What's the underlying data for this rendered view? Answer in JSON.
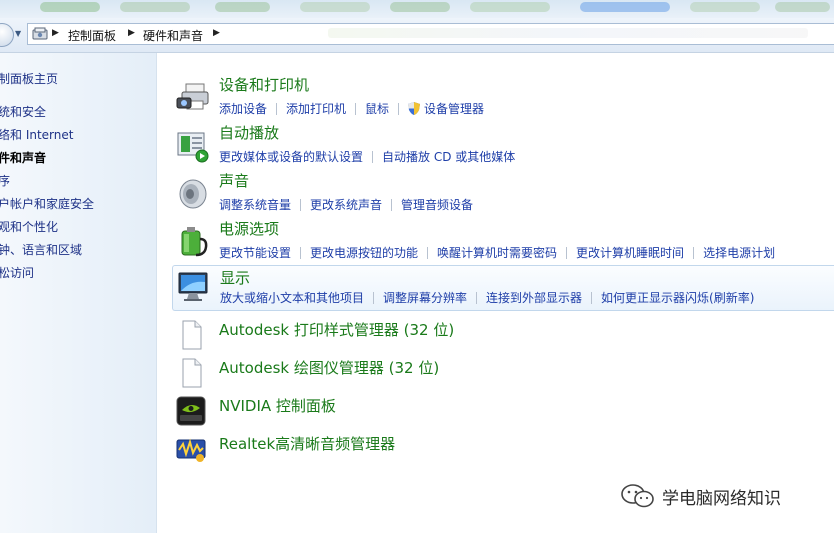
{
  "address_bar": {
    "crumbs": [
      "控制面板",
      "硬件和声音"
    ]
  },
  "left_pane": {
    "items": [
      {
        "label": "制面板主页",
        "active": false
      },
      {
        "label": "统和安全",
        "active": false
      },
      {
        "label": "络和 Internet",
        "active": false
      },
      {
        "label": "件和声音",
        "active": true
      },
      {
        "label": "序",
        "active": false
      },
      {
        "label": "户帐户和家庭安全",
        "active": false
      },
      {
        "label": "观和个性化",
        "active": false
      },
      {
        "label": "钟、语言和区域",
        "active": false
      },
      {
        "label": "松访问",
        "active": false
      }
    ]
  },
  "categories": [
    {
      "title": "设备和打印机",
      "icon": "devices-printers-icon",
      "links": [
        "添加设备",
        "添加打印机",
        "鼠标",
        "设备管理器"
      ]
    },
    {
      "title": "自动播放",
      "icon": "autoplay-icon",
      "links": [
        "更改媒体或设备的默认设置",
        "自动播放 CD 或其他媒体"
      ]
    },
    {
      "title": "声音",
      "icon": "speaker-icon",
      "links": [
        "调整系统音量",
        "更改系统声音",
        "管理音频设备"
      ]
    },
    {
      "title": "电源选项",
      "icon": "power-options-icon",
      "links": [
        "更改节能设置",
        "更改电源按钮的功能",
        "唤醒计算机时需要密码",
        "更改计算机睡眠时间",
        "选择电源计划"
      ]
    },
    {
      "title": "显示",
      "icon": "display-icon",
      "links": [
        "放大或缩小文本和其他项目",
        "调整屏幕分辨率",
        "连接到外部显示器",
        "如何更正显示器闪烁(刷新率)"
      ]
    }
  ],
  "extra_items": [
    {
      "title": "Autodesk 打印样式管理器 (32 位)",
      "icon": "document-icon"
    },
    {
      "title": "Autodesk 绘图仪管理器 (32 位)",
      "icon": "document-icon"
    },
    {
      "title": "NVIDIA 控制面板",
      "icon": "nvidia-icon"
    },
    {
      "title": "Realtek高清晰音频管理器",
      "icon": "realtek-audio-icon"
    }
  ],
  "watermark": {
    "text": "学电脑网络知识"
  },
  "colors": {
    "category_title": "#1a7a1a",
    "link": "#1e3ea8",
    "left_pane_link": "#1e3287",
    "highlight_border": "#c2d7ec"
  }
}
